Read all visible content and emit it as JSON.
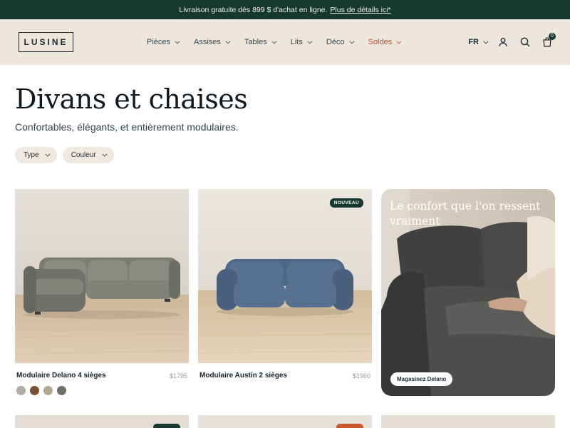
{
  "announcement": {
    "text": "Livraison gratuite dès 899 $ d'achat en ligne.",
    "link": "Plus de détails ici*"
  },
  "header": {
    "logo": "LUSINE",
    "nav": [
      {
        "label": "Pièces"
      },
      {
        "label": "Assises"
      },
      {
        "label": "Tables"
      },
      {
        "label": "Lits"
      },
      {
        "label": "Déco"
      },
      {
        "label": "Soldes",
        "color": "#c44f2e"
      }
    ],
    "lang": "FR",
    "cart_count": "0",
    "icons": [
      "user-icon",
      "search-icon",
      "cart-icon"
    ]
  },
  "page": {
    "title": "Divans et chaises",
    "subtitle": "Confortables, élégants, et entièrement modulaires."
  },
  "filters": [
    {
      "label": "Type"
    },
    {
      "label": "Couleur"
    }
  ],
  "products": [
    {
      "name": "Modulaire Delano 4 sièges",
      "price": "$1795",
      "swatches": [
        "#b0aca3",
        "#7a5034",
        "#b5a694",
        "#6f706a"
      ]
    },
    {
      "name": "Modulaire Austin 2 sièges",
      "price": "$1960",
      "badge": "NOUVEAU"
    }
  ],
  "promo": {
    "text": "Le confort que l'on ressent vraiment",
    "button": "Magasinez Delano"
  },
  "colors": {
    "brand_dark": "#17382f",
    "header_bg": "#ece6dd",
    "sale": "#c44f2e",
    "next_badges": [
      "#17382f",
      "#c8572e"
    ]
  }
}
